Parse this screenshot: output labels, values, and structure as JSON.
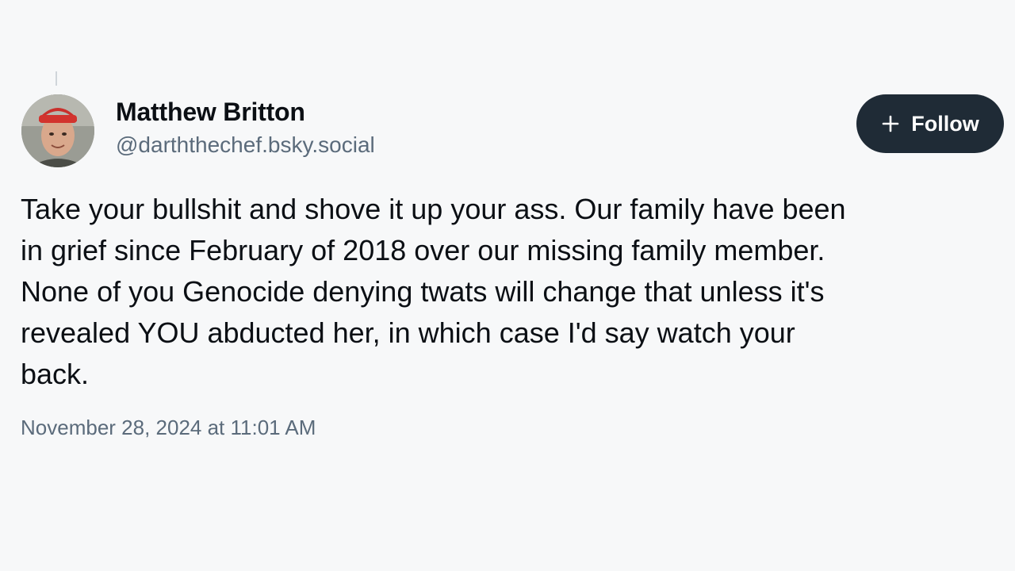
{
  "post": {
    "author": {
      "display_name": "Matthew Britton",
      "handle": "@darththechef.bsky.social",
      "avatar_icon": "profile-photo"
    },
    "follow_button": {
      "label": "Follow",
      "icon": "plus-icon"
    },
    "text_lines": [
      "Take your bullshit and shove it up your ass. Our family have been",
      "in grief since February of 2018 over our missing family member.",
      "None of you Genocide denying twats will change that unless it's",
      "revealed YOU abducted her, in which case I'd say watch your",
      "back."
    ],
    "timestamp": "November 28, 2024 at 11:01 AM"
  },
  "colors": {
    "background": "#f7f8f9",
    "text_primary": "#0b0f14",
    "text_secondary": "#5b6b7b",
    "button_bg": "#1f2b36",
    "button_text": "#ffffff"
  }
}
